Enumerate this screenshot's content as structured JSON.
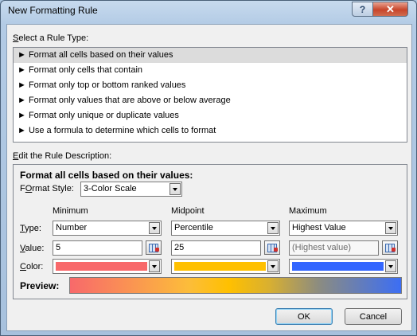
{
  "window": {
    "title": "New Formatting Rule",
    "help_label": "?",
    "close_label": "✕"
  },
  "rule_type": {
    "heading": "Select a Rule Type:",
    "heading_key": "S",
    "heading_rest": "elect a Rule Type:",
    "items": [
      {
        "label": "► Format all cells based on their values"
      },
      {
        "label": "► Format only cells that contain"
      },
      {
        "label": "► Format only top or bottom ranked values"
      },
      {
        "label": "► Format only values that are above or below average"
      },
      {
        "label": "► Format only unique or duplicate values"
      },
      {
        "label": "► Use a formula to determine which cells to format"
      }
    ]
  },
  "description": {
    "heading_key": "E",
    "heading_rest": "dit the Rule Description:",
    "title": "Format all cells based on their values:",
    "format_style_key": "O",
    "format_style_label_pre": "F",
    "format_style_label_post": "rmat Style:",
    "format_style_value": "3-Color Scale",
    "row_type_key": "T",
    "row_type_rest": "ype:",
    "row_value_key": "V",
    "row_value_rest": "alue:",
    "row_color_key": "C",
    "row_color_rest": "olor:",
    "columns": [
      {
        "header": "Minimum",
        "type": "Number",
        "value": "5",
        "color": "#f8696b"
      },
      {
        "header": "Midpoint",
        "type": "Percentile",
        "value": "25",
        "color": "#ffc000"
      },
      {
        "header": "Maximum",
        "type": "Highest Value",
        "value": "(Highest value)",
        "color": "#3366ff"
      }
    ],
    "preview_label": "Preview:"
  },
  "buttons": {
    "ok": "OK",
    "cancel": "Cancel"
  }
}
